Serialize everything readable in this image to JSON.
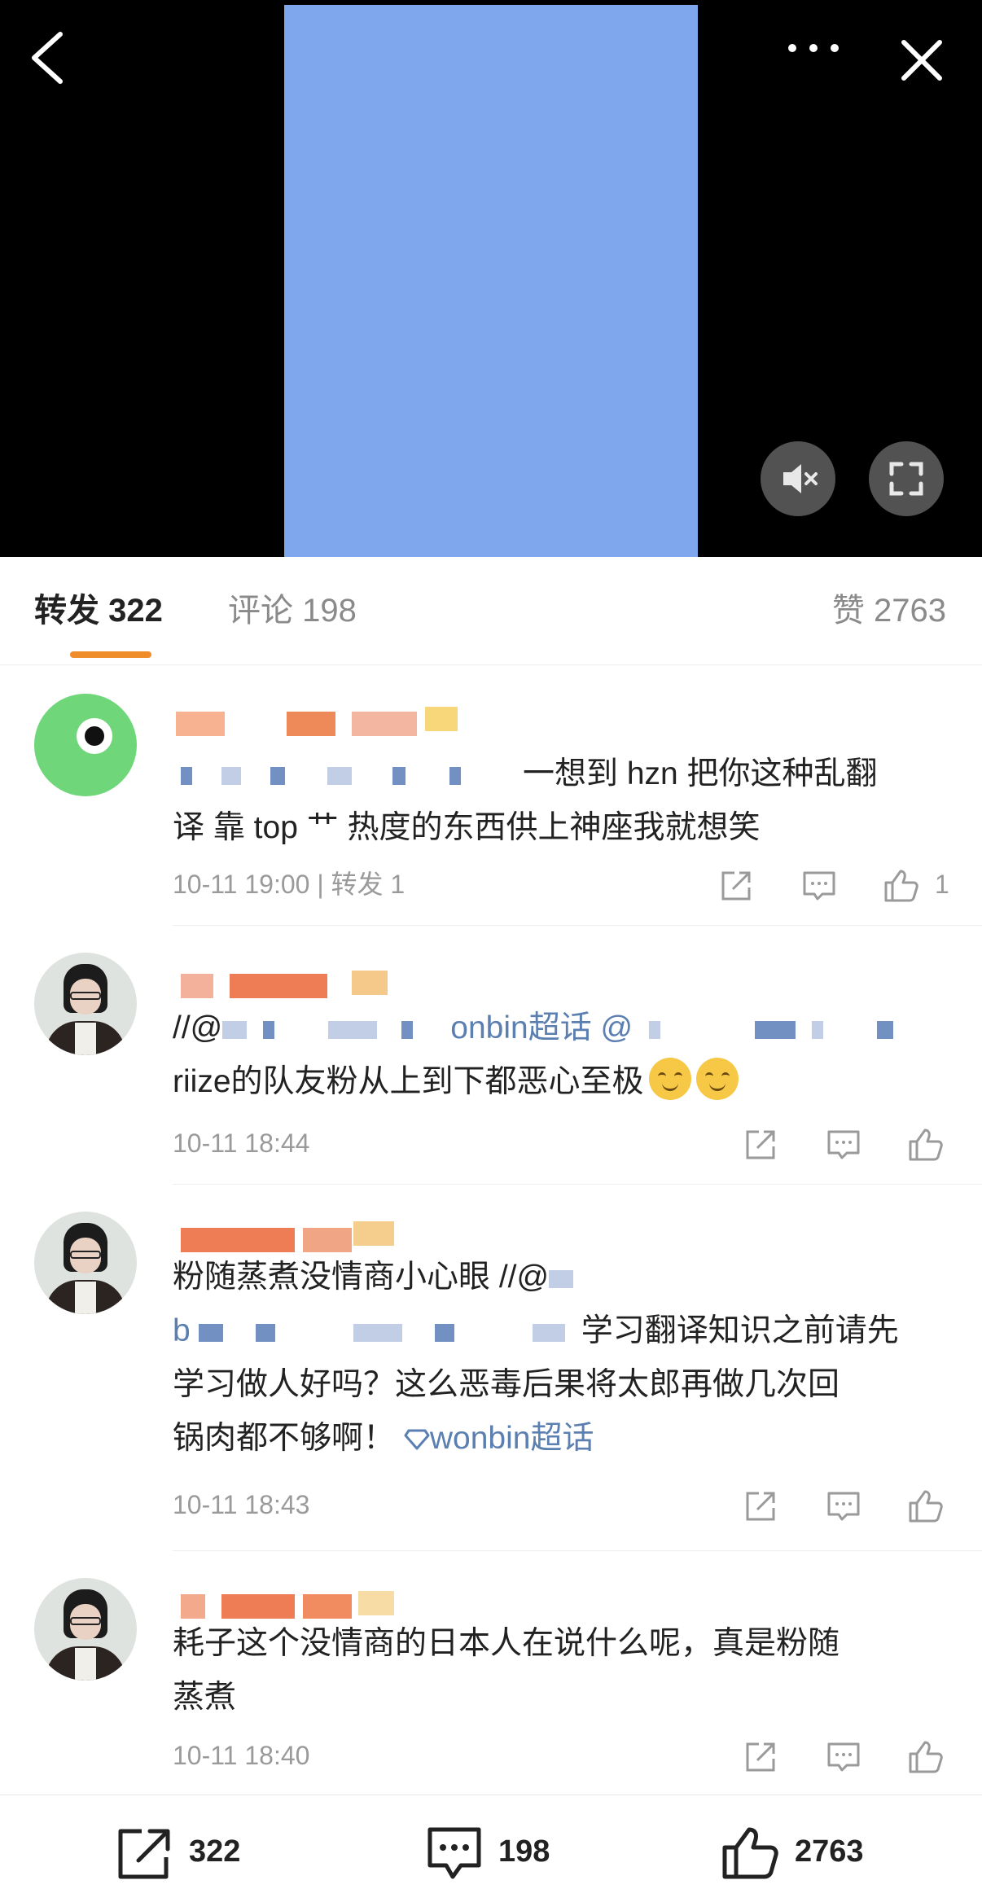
{
  "video": {
    "controls": {
      "back": "back-icon",
      "more": "more-icon",
      "close": "close-icon",
      "mute": "mute-icon",
      "fullscreen": "fullscreen-icon"
    }
  },
  "tabs": {
    "repost": "转发 322",
    "comment": "评论 198",
    "like": "赞 2763"
  },
  "posts": [
    {
      "text_plain": "一想到hzn把你这种乱翻译 靠top艹热度的东西供上神座我就想笑",
      "line1": "一想到 hzn 把你这种乱翻",
      "line2": "译 靠 top 艹 热度的东西供上神座我就想笑",
      "time": "10-11 19:00",
      "repost_label": "转发 1",
      "like_count": "1"
    },
    {
      "line1_prefix": "//@",
      "line1_link": "onbin超话 @",
      "line2": "riize的队友粉从上到下都恶心至极",
      "time": "10-11 18:44"
    },
    {
      "line1": "粉随蒸煮没情商小心眼 //@",
      "line2_prefix": "b",
      "line2": "学习翻译知识之前请先",
      "line3": "学习做人好吗？这么恶毒后果将太郎再做几次回",
      "line4": "锅肉都不够啊！",
      "topic": "wonbin超话",
      "time": "10-11 18:43"
    },
    {
      "line1": "耗子这个没情商的日本人在说什么呢，真是粉随",
      "line2": "蒸煮",
      "time": "10-11 18:40"
    }
  ],
  "bottom_bar": {
    "repost_count": "322",
    "comment_count": "198",
    "like_count": "2763"
  },
  "colors": {
    "accent": "#f08d2b",
    "link": "#5b7fb0",
    "video_frame": "#7ea7ee"
  }
}
